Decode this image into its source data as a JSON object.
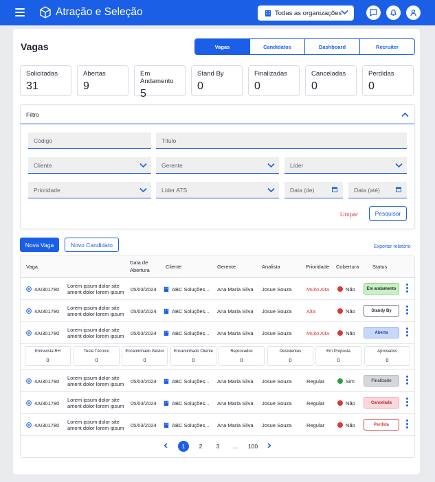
{
  "app": {
    "title": "Atração e Seleção"
  },
  "header": {
    "org_select": "Todas as organizações"
  },
  "page": {
    "title": "Vagas"
  },
  "tabs": [
    "Vagas",
    "Candidatos",
    "Dashboard",
    "Recruiter"
  ],
  "stats": [
    {
      "label": "Solicitadas",
      "value": "31"
    },
    {
      "label": "Abertas",
      "value": "9"
    },
    {
      "label": "Em Andamento",
      "value": "5"
    },
    {
      "label": "Stand By",
      "value": "0"
    },
    {
      "label": "Finalizadas",
      "value": "0"
    },
    {
      "label": "Canceladas",
      "value": "0"
    },
    {
      "label": "Perdidas",
      "value": "0"
    }
  ],
  "filter": {
    "title": "Filtro",
    "codigo": "Código",
    "titulo": "Título",
    "cliente": "Cliente",
    "gerente": "Gerente",
    "lider": "Líder",
    "prioridade": "Prioridade",
    "lider_ats": "Líder ATS",
    "data_de": "Data (de)",
    "data_ate": "Data (até)",
    "limpar": "Limpar",
    "pesquisar": "Pesquisar"
  },
  "actions": {
    "nova_vaga": "Nova Vaga",
    "novo_candidato": "Novo Candidato",
    "exportar": "Exportar relatório"
  },
  "table": {
    "headers": {
      "vaga": "Vaga",
      "data1": "Data de",
      "data2": "Abertura",
      "cliente": "Cliente",
      "gerente": "Gerente",
      "analista": "Analista",
      "prioridade": "Prioridade",
      "cobertura": "Cobertura",
      "status": "Status"
    },
    "rows": [
      {
        "code": "4AI301780",
        "desc1": "Lorem ipsum dolor site",
        "desc2": "ament dolor lorem ipsum",
        "date": "05/03/2024",
        "client": "ABC Soluções...",
        "manager": "Ana Maria Silva",
        "analyst": "Josue Souza",
        "priority": "Muito Alta",
        "coverage": "Não",
        "status": "Em andamento"
      },
      {
        "code": "4AI301780",
        "desc1": "Lorem ipsum dolor site",
        "desc2": "ament dolor lorem ipsum",
        "date": "05/03/2024",
        "client": "ABC Soluções...",
        "manager": "Ana Maria Silva",
        "analyst": "Josue Souza",
        "priority": "Alta",
        "coverage": "Não",
        "status": "Standy By"
      },
      {
        "code": "4AI301780",
        "desc1": "Lorem ipsum dolor site",
        "desc2": "ament dolor lorem ipsum",
        "date": "05/03/2024",
        "client": "ABC Soluções...",
        "manager": "Ana Maria Silva",
        "analyst": "Josue Souza",
        "priority": "Muito Alta",
        "coverage": "Não",
        "status": "Aberta"
      },
      {
        "code": "4AI301780",
        "desc1": "Lorem ipsum dolor site",
        "desc2": "ament dolor lorem ipsum",
        "date": "05/03/2024",
        "client": "ABC Soluções...",
        "manager": "Ana Maria Silva",
        "analyst": "Josue Souza",
        "priority": "Regular",
        "coverage": "Sim",
        "status": "Finalizado"
      },
      {
        "code": "4AI301780",
        "desc1": "Lorem ipsum dolor site",
        "desc2": "ament dolor lorem ipsum",
        "date": "05/03/2024",
        "client": "ABC Soluções...",
        "manager": "Ana Maria Silva",
        "analyst": "Josue Souza",
        "priority": "Regular",
        "coverage": "Não",
        "status": "Cancelada"
      },
      {
        "code": "4AI301780",
        "desc1": "Lorem ipsum dolor site",
        "desc2": "ament dolor lorem ipsum",
        "date": "05/03/2024",
        "client": "ABC Soluções...",
        "manager": "Ana Maria Silva",
        "analyst": "Josue Souza",
        "priority": "Regular",
        "coverage": "Não",
        "status": "Perdida"
      }
    ],
    "pipeline": [
      {
        "label": "Entrevista RH",
        "value": "0"
      },
      {
        "label": "Teste Técnico",
        "value": "0"
      },
      {
        "label": "Encaminhado Gestor",
        "value": "0"
      },
      {
        "label": "Encaminhado Cliente",
        "value": "0"
      },
      {
        "label": "Reprovados",
        "value": "0"
      },
      {
        "label": "Desistentes",
        "value": "0"
      },
      {
        "label": "Em Proposta",
        "value": "0"
      },
      {
        "label": "Aprovados",
        "value": "0"
      }
    ]
  },
  "pagination": [
    "1",
    "2",
    "3",
    "...",
    "100"
  ],
  "colors": {
    "primary": "#1b5fe6",
    "danger": "#d63b3b",
    "success": "#2e9e45"
  }
}
